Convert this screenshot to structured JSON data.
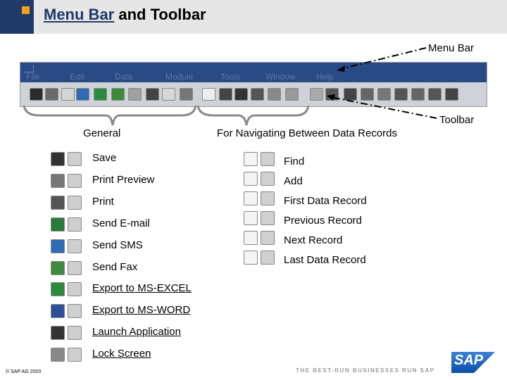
{
  "slide": {
    "title_part1": "Menu Bar",
    "title_part2": " and Toolbar"
  },
  "callouts": {
    "menu_bar": "Menu Bar",
    "toolbar": "Toolbar"
  },
  "sap_menu": [
    "File",
    "Edit",
    "Data",
    "Module",
    "Tools",
    "Window",
    "Help"
  ],
  "groups": {
    "general": "General",
    "navigating": "For Navigating Between Data Records"
  },
  "general_items": [
    {
      "label": "Save",
      "icon": "save-icon",
      "link": false
    },
    {
      "label": "Print Preview",
      "icon": "print-preview-icon",
      "link": false
    },
    {
      "label": "Print",
      "icon": "print-icon",
      "link": false
    },
    {
      "label": "Send E-mail",
      "icon": "email-icon",
      "link": false
    },
    {
      "label": "Send SMS",
      "icon": "sms-icon",
      "link": false
    },
    {
      "label": "Send Fax",
      "icon": "fax-icon",
      "link": false
    },
    {
      "label": "Export to MS-EXCEL",
      "icon": "excel-icon",
      "link": true
    },
    {
      "label": "Export to MS-WORD",
      "icon": "word-icon",
      "link": true
    },
    {
      "label": "Launch Application",
      "icon": "launch-icon",
      "link": true
    },
    {
      "label": "Lock Screen",
      "icon": "lock-icon",
      "link": true
    }
  ],
  "nav_items": [
    {
      "label": "Find",
      "icon": "find-icon"
    },
    {
      "label": "Add",
      "icon": "add-icon"
    },
    {
      "label": "First Data Record",
      "icon": "first-record-icon"
    },
    {
      "label": "Previous Record",
      "icon": "previous-record-icon"
    },
    {
      "label": "Next Record",
      "icon": "next-record-icon"
    },
    {
      "label": "Last Data Record",
      "icon": "last-record-icon"
    }
  ],
  "footer": {
    "copyright": "© SAP AG 2003",
    "tagline": "THE BEST-RUN BUSINESSES RUN SAP",
    "logo": "SAP"
  },
  "colors": {
    "header_bg": "#e6e6e6",
    "corner": "#1f3a68",
    "accent": "#f0a020",
    "menubar": "#2a4a86",
    "toolbar": "#cfd3d8"
  }
}
